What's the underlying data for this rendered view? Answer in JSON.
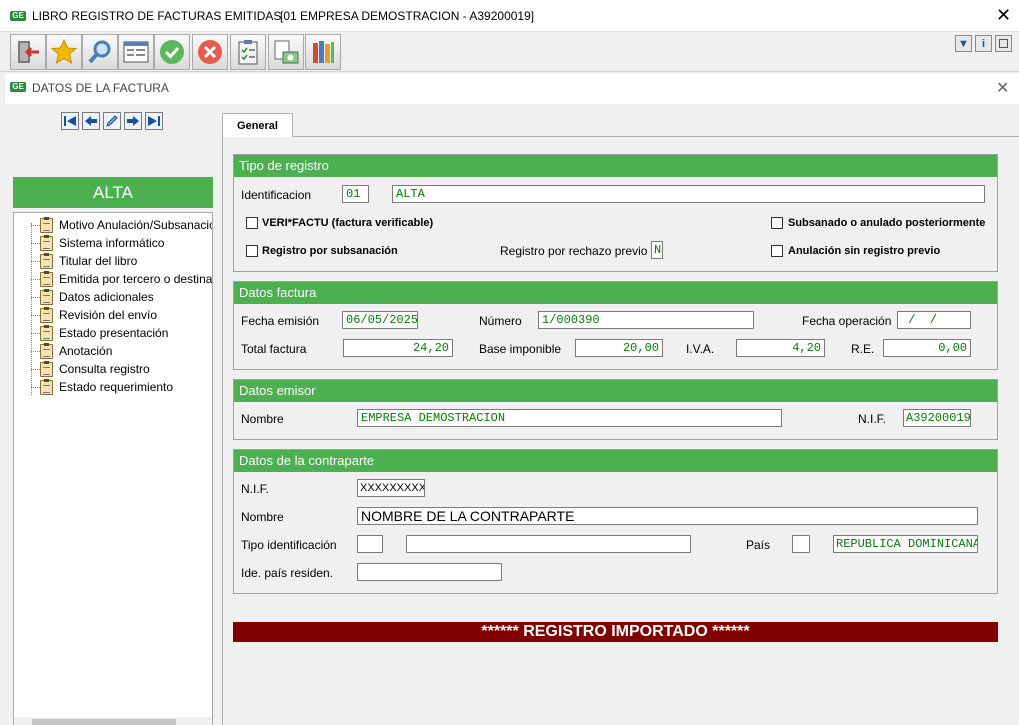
{
  "window": {
    "title": "LIBRO REGISTRO DE FACTURAS EMITIDAS",
    "company": "[01  EMPRESA DEMOSTRACION - A39200019]",
    "logo": "GE"
  },
  "toolbar": {
    "icons": [
      "exit-icon",
      "favorite-star-icon",
      "search-icon",
      "window-list-icon",
      "accept-icon",
      "cancel-icon",
      "clipboard-check-icon",
      "documents-money-icon",
      "books-icon"
    ],
    "small_icons": [
      "chevron-down-icon",
      "info-icon",
      "maximize-icon"
    ],
    "info_label": "i"
  },
  "inner_window": {
    "title": "DATOS DE LA FACTURA",
    "logo": "GE"
  },
  "sidebar": {
    "status": "ALTA",
    "items": [
      {
        "label": "Motivo Anulación/Subsanación"
      },
      {
        "label": "Sistema informático"
      },
      {
        "label": "Titular del libro"
      },
      {
        "label": "Emitida por tercero o destinatario"
      },
      {
        "label": "Datos adicionales"
      },
      {
        "label": "Revisión del envío"
      },
      {
        "label": "Estado presentación"
      },
      {
        "label": "Anotación"
      },
      {
        "label": "Consulta registro"
      },
      {
        "label": "Estado requerimiento"
      }
    ]
  },
  "tabs": [
    {
      "label": "General"
    }
  ],
  "tipo_registro": {
    "header": "Tipo de registro",
    "identificacion_label": "Identificacion",
    "identificacion_code": "01",
    "identificacion_desc": "ALTA",
    "verifactu_label": "VERI*FACTU (factura verificable)",
    "subsanado_label": "Subsanado o anulado posteriormente",
    "registro_subsanacion_label": "Registro por subsanación",
    "rechazo_label": "Registro por rechazo previo",
    "rechazo_value": "N",
    "anulacion_label": "Anulación sin registro previo"
  },
  "datos_factura": {
    "header": "Datos factura",
    "fecha_emision_label": "Fecha emisión",
    "fecha_emision": "06/05/2025",
    "numero_label": "Número",
    "numero": "1/000390",
    "fecha_operacion_label": "Fecha operación",
    "fecha_operacion": " /  /",
    "total_label": "Total factura",
    "total": "24,20",
    "base_label": "Base imponible",
    "base": "20,00",
    "iva_label": "I.V.A.",
    "iva": "4,20",
    "re_label": "R.E.",
    "re": "0,00"
  },
  "datos_emisor": {
    "header": "Datos emisor",
    "nombre_label": "Nombre",
    "nombre": "EMPRESA DEMOSTRACION",
    "nif_label": "N.I.F.",
    "nif": "A39200019"
  },
  "contraparte": {
    "header": "Datos de la contraparte",
    "nif_label": "N.I.F.",
    "nif": "XXXXXXXXX",
    "nombre_label": "Nombre",
    "nombre": "NOMBRE DE LA CONTRAPARTE",
    "tipo_label": "Tipo identificación",
    "tipo_code": "",
    "tipo_desc": "",
    "pais_label": "País",
    "pais_code": "",
    "pais_desc": "REPUBLICA DOMINICANA",
    "ide_label": "Ide. país residen.",
    "ide": ""
  },
  "banner": "****** REGISTRO IMPORTADO ******",
  "colors": {
    "section_header": "#4caf50",
    "banner": "#800000",
    "field_text": "#0a7a0a"
  }
}
